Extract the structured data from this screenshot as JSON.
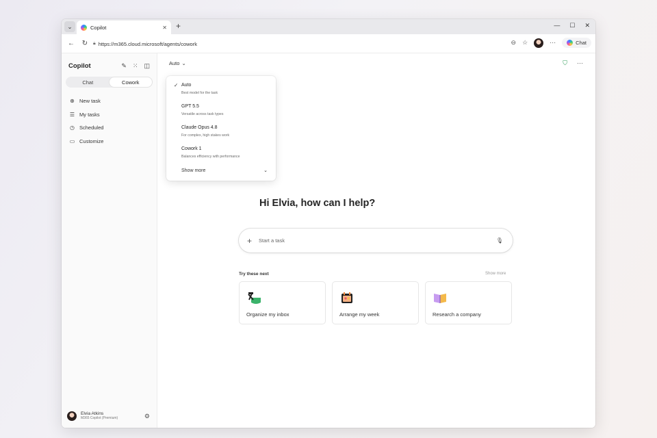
{
  "browser": {
    "tab_title": "Copilot",
    "url": "https://m365.cloud.microsoft/agents/cowork",
    "chat_label": "Chat"
  },
  "sidebar": {
    "title": "Copilot",
    "segments": [
      "Chat",
      "Cowork"
    ],
    "active_segment": "Cowork",
    "nav": [
      {
        "label": "New task",
        "icon": "plus-circle-icon"
      },
      {
        "label": "My tasks",
        "icon": "list-icon"
      },
      {
        "label": "Scheduled",
        "icon": "clock-icon"
      },
      {
        "label": "Customize",
        "icon": "briefcase-icon"
      }
    ],
    "user": {
      "name": "Elvia Atkins",
      "plan": "M365 Copilot (Premium)"
    }
  },
  "main": {
    "model_selected": "Auto",
    "dropdown": {
      "options": [
        {
          "name": "Auto",
          "desc": "Best model for the task",
          "selected": true
        },
        {
          "name": "GPT 5.5",
          "desc": "Versatile across task types",
          "selected": false
        },
        {
          "name": "Claude Opus 4.8",
          "desc": "For complex, high stakes work",
          "selected": false
        },
        {
          "name": "Cowork 1",
          "desc": "Balances efficiency with performance",
          "selected": false
        }
      ],
      "show_more": "Show more"
    },
    "greeting": "Hi Elvia, how can I help?",
    "input_placeholder": "Start a task",
    "try_label": "Try these next",
    "try_more": "Show more",
    "cards": [
      {
        "label": "Organize my inbox",
        "icon": "inbox-organize-icon"
      },
      {
        "label": "Arrange my week",
        "icon": "calendar-icon"
      },
      {
        "label": "Research a company",
        "icon": "book-icon"
      }
    ]
  },
  "colors": {
    "accent_green": "#2b9a55",
    "window_bg": "#ffffff"
  }
}
